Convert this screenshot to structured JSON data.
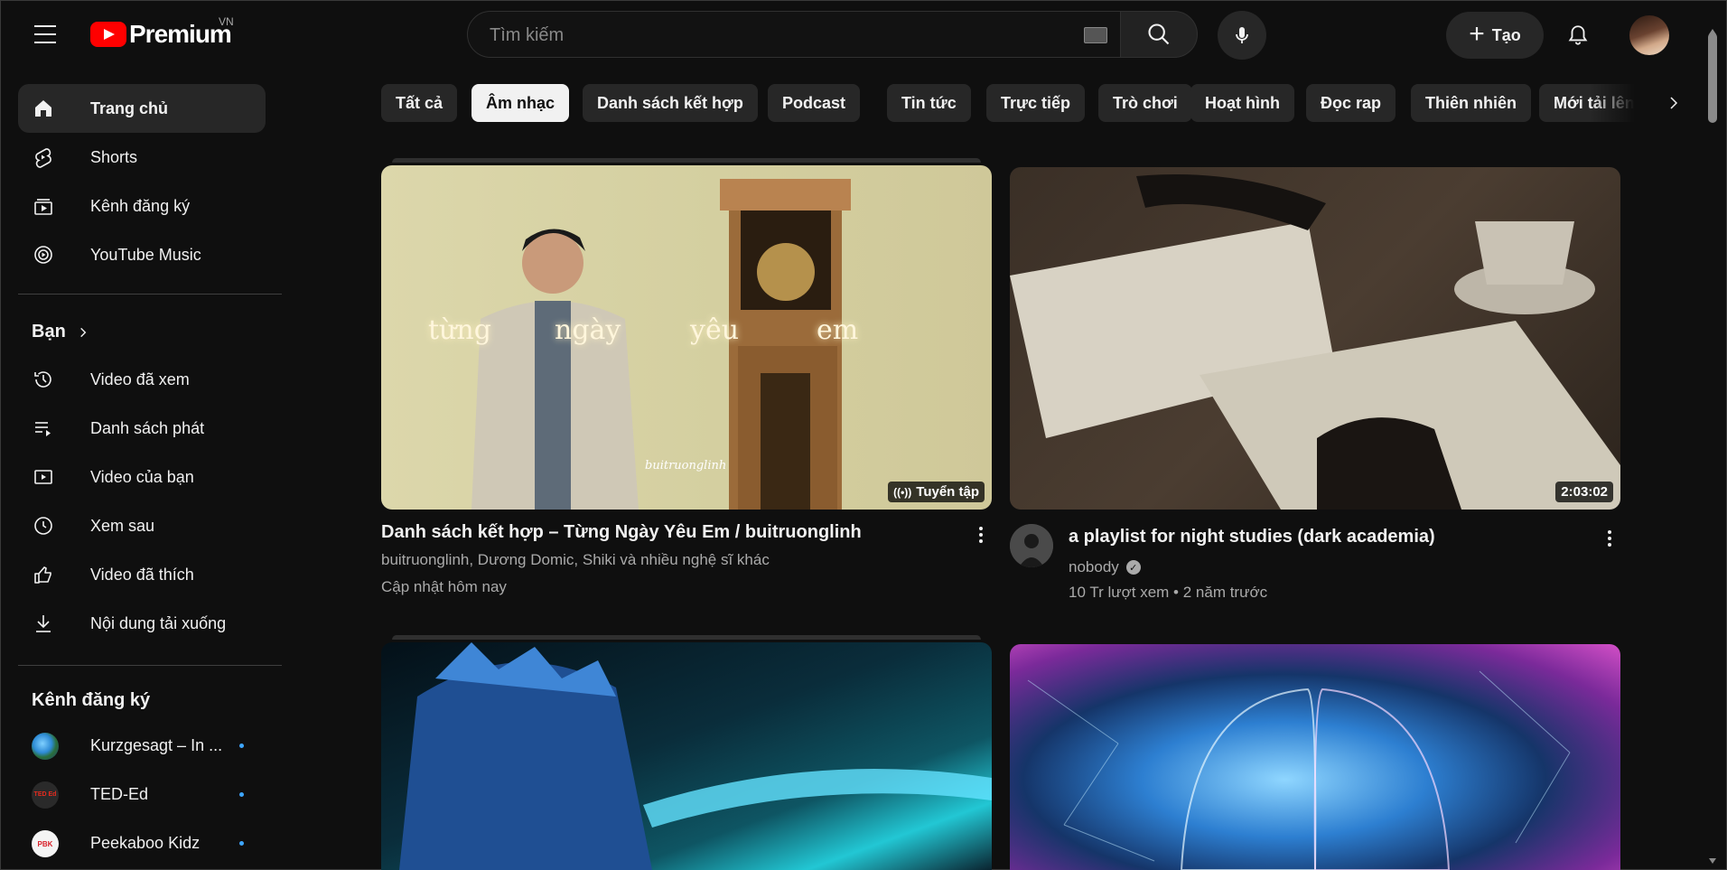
{
  "header": {
    "logo_text": "Premium",
    "country_code": "VN",
    "search_placeholder": "Tìm kiếm",
    "create_label": "Tạo"
  },
  "sidebar": {
    "primary": [
      {
        "label": "Trang chủ",
        "icon": "home-icon",
        "active": true
      },
      {
        "label": "Shorts",
        "icon": "shorts-icon"
      },
      {
        "label": "Kênh đăng ký",
        "icon": "subscriptions-icon"
      },
      {
        "label": "YouTube Music",
        "icon": "youtube-music-icon"
      }
    ],
    "you_section_label": "Bạn",
    "you": [
      {
        "label": "Video đã xem",
        "icon": "history-icon"
      },
      {
        "label": "Danh sách phát",
        "icon": "playlists-icon"
      },
      {
        "label": "Video của bạn",
        "icon": "your-videos-icon"
      },
      {
        "label": "Xem sau",
        "icon": "watch-later-icon"
      },
      {
        "label": "Video đã thích",
        "icon": "like-icon"
      },
      {
        "label": "Nội dung tải xuống",
        "icon": "download-icon"
      }
    ],
    "subscriptions_label": "Kênh đăng ký",
    "subscriptions": [
      {
        "label": "Kurzgesagt – In ...",
        "avatar_text": ""
      },
      {
        "label": "TED-Ed",
        "avatar_text": "TED Ed"
      },
      {
        "label": "Peekaboo Kidz",
        "avatar_text": "PBK"
      }
    ]
  },
  "chips": [
    {
      "label": "Tất cả",
      "active": false
    },
    {
      "label": "Âm nhạc",
      "active": true
    },
    {
      "label": "Danh sách kết hợp",
      "active": false
    },
    {
      "label": "Podcast",
      "active": false
    },
    {
      "label": "Tin tức",
      "active": false
    },
    {
      "label": "Trực tiếp",
      "active": false
    },
    {
      "label": "Trò chơi",
      "active": false
    },
    {
      "label": "Hoạt hình",
      "active": false
    },
    {
      "label": "Đọc rap",
      "active": false
    },
    {
      "label": "Thiên nhiên",
      "active": false
    },
    {
      "label": "Mới tải lên",
      "active": false
    }
  ],
  "videos": [
    {
      "title": "Danh sách kết hợp – Từng Ngày Yêu Em / buitruonglinh",
      "meta1": "buitruonglinh, Dương Domic, Shiki và nhiều nghệ sĩ khác",
      "meta2": "Cập nhật hôm nay",
      "badge": "Tuyển tập",
      "overlay": [
        "từng",
        "ngày",
        "yêu",
        "em"
      ],
      "signature": "buitruonglinh"
    },
    {
      "title": "a playlist for night studies (dark academia)",
      "channel": "nobody",
      "stats": "10 Tr lượt xem • 2 năm trước",
      "duration": "2:03:02"
    }
  ],
  "colors": {
    "background": "#0f0f0f",
    "surface": "#272727",
    "accent_red": "#ff0000",
    "text_primary": "#f1f1f1",
    "text_secondary": "#aaaaaa",
    "new_dot": "#3ea6ff"
  }
}
